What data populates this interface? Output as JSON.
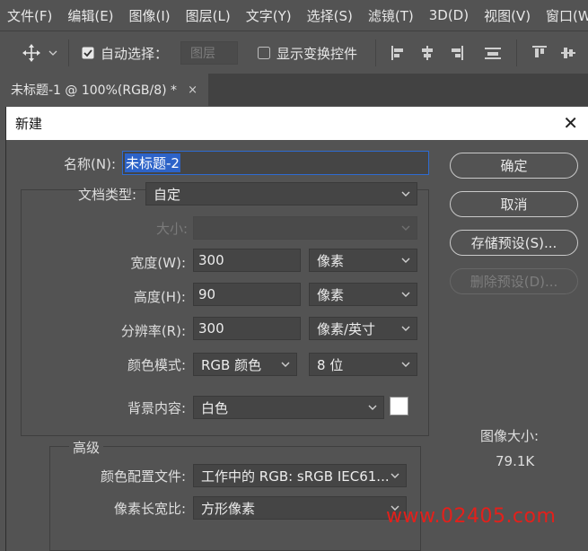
{
  "menu": [
    "文件(F)",
    "编辑(E)",
    "图像(I)",
    "图层(L)",
    "文字(Y)",
    "选择(S)",
    "滤镜(T)",
    "3D(D)",
    "视图(V)",
    "窗口(W)"
  ],
  "options": {
    "auto_select_label": "自动选择：",
    "auto_select_checked": true,
    "auto_select_target": "图层",
    "show_transform_label": "显示变换控件",
    "show_transform_checked": false
  },
  "doc_tab": {
    "title": "未标题-1 @ 100%(RGB/8) *",
    "close": "×"
  },
  "dialog": {
    "title": "新建",
    "close": "✕",
    "name_label": "名称(N):",
    "name_value": "未标题-2",
    "doc_type_label": "文档类型:",
    "doc_type_value": "自定",
    "size_label": "大小:",
    "size_value": "",
    "width_label": "宽度(W):",
    "width_value": "300",
    "width_unit": "像素",
    "height_label": "高度(H):",
    "height_value": "90",
    "height_unit": "像素",
    "resolution_label": "分辨率(R):",
    "resolution_value": "300",
    "resolution_unit": "像素/英寸",
    "color_mode_label": "颜色模式:",
    "color_mode_value": "RGB 颜色",
    "bit_depth_value": "8 位",
    "background_label": "背景内容:",
    "background_value": "白色",
    "background_swatch": "#ffffff",
    "advanced_label": "高级",
    "color_profile_label": "颜色配置文件:",
    "color_profile_value": "工作中的 RGB: sRGB IEC61...",
    "pixel_aspect_label": "像素长宽比:",
    "pixel_aspect_value": "方形像素",
    "buttons": {
      "ok": "确定",
      "cancel": "取消",
      "save_preset": "存储预设(S)...",
      "delete_preset": "删除预设(D)..."
    },
    "image_size_label": "图像大小:",
    "image_size_value": "79.1K"
  },
  "watermark": "www.02405.com",
  "colors": {
    "accent_blue": "#2d63c8",
    "watermark_red": "#e3201b"
  }
}
